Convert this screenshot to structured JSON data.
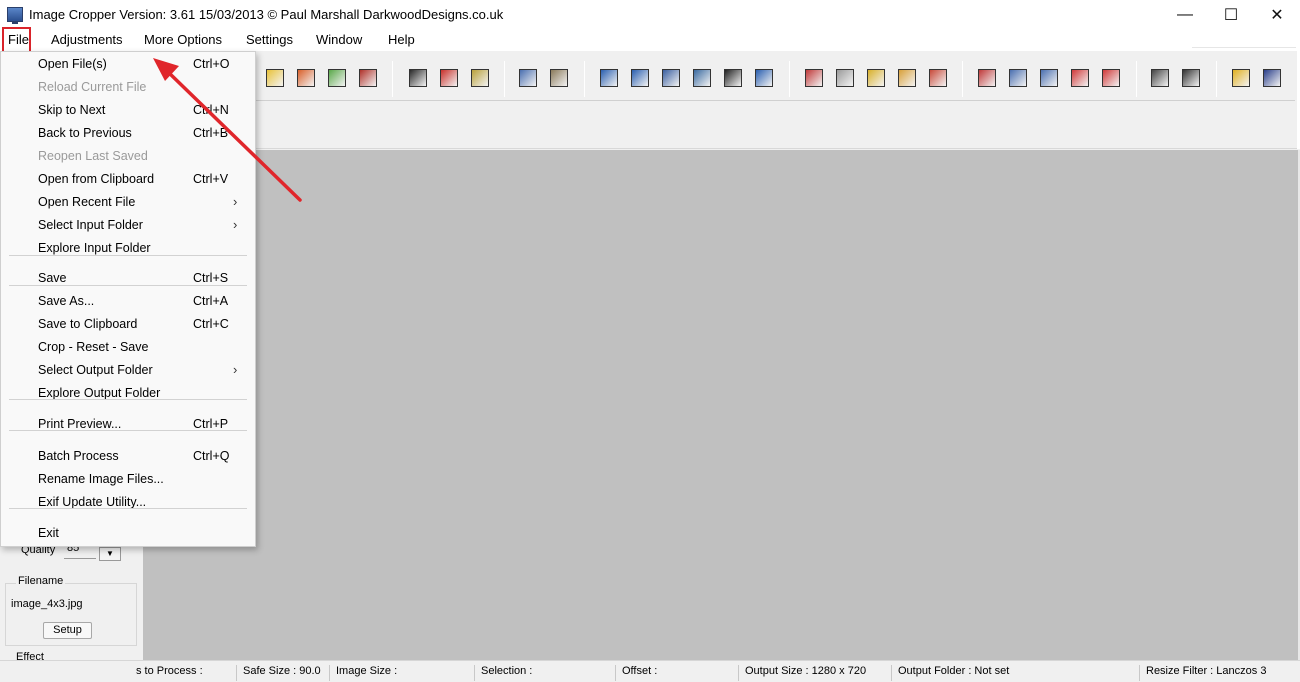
{
  "window": {
    "title": "Image Cropper  Version: 3.61  15/03/2013  © Paul Marshall     DarkwoodDesigns.co.uk",
    "minimize": "—",
    "maximize": "☐",
    "close": "✕"
  },
  "menubar": {
    "file": "File",
    "adjustments": "Adjustments",
    "more_options": "More Options",
    "settings": "Settings",
    "window": "Window",
    "help": "Help"
  },
  "file_menu": {
    "items": [
      {
        "label": "Open File(s)",
        "shortcut": "Ctrl+O",
        "disabled": false
      },
      {
        "label": "Reload Current File",
        "shortcut": "",
        "disabled": true
      },
      {
        "label": "Skip to Next",
        "shortcut": "Ctrl+N",
        "disabled": false
      },
      {
        "label": "Back to Previous",
        "shortcut": "Ctrl+B",
        "disabled": false
      },
      {
        "label": "Reopen Last Saved",
        "shortcut": "",
        "disabled": true
      },
      {
        "label": "Open from Clipboard",
        "shortcut": "Ctrl+V",
        "disabled": false
      },
      {
        "label": "Open Recent File",
        "submenu": true
      },
      {
        "label": "Select Input Folder",
        "submenu": true
      },
      {
        "label": "Explore Input Folder",
        "shortcut": ""
      },
      {
        "label": "Save",
        "shortcut": "Ctrl+S"
      },
      {
        "label": "Save As...",
        "shortcut": "Ctrl+A"
      },
      {
        "label": "Save to Clipboard",
        "shortcut": "Ctrl+C"
      },
      {
        "label": "Crop - Reset - Save",
        "shortcut": ""
      },
      {
        "label": "Select Output Folder",
        "submenu": true
      },
      {
        "label": "Explore Output Folder",
        "shortcut": ""
      },
      {
        "label": "Print Preview...",
        "shortcut": "Ctrl+P"
      },
      {
        "label": "Batch Process",
        "shortcut": "Ctrl+Q"
      },
      {
        "label": "Rename Image Files...",
        "shortcut": ""
      },
      {
        "label": "Exif Update Utility...",
        "shortcut": ""
      },
      {
        "label": "Exit",
        "shortcut": ""
      }
    ],
    "submenu_arrow": "›"
  },
  "left_panel": {
    "quality_label": "Quality",
    "quality_value": "85",
    "quality_down": "▼",
    "filename_legend": "Filename",
    "filename_value": "image_4x3.jpg",
    "setup_button": "Setup",
    "effect_label": "Effect"
  },
  "statusbar": {
    "to_process": "s to Process :",
    "safe_size": "Safe Size : 90.0",
    "image_size": "Image Size :",
    "selection": "Selection :",
    "offset": "Offset :",
    "output_size": "Output Size : 1280 x 720",
    "output_folder": "Output Folder : Not set",
    "resize_filter": "Resize Filter : Lanczos 3"
  },
  "toolbar_icons": [
    "open-folder-icon",
    "open-images-icon",
    "print-icon",
    "batch-icon",
    "save-icon",
    "save-red-icon",
    "save-multi-icon",
    "copy-icon",
    "paste-icon",
    "rotate-right-icon",
    "rotate-left-icon",
    "flip-icon",
    "flip-horizontal-icon",
    "grayscale-icon",
    "undo-icon",
    "frame-icon",
    "blank-icon",
    "fit-height-icon",
    "fit-width-icon",
    "stretch-icon",
    "preview-icon",
    "grid-icon",
    "grid-center-icon",
    "crop-corners-icon",
    "crop-lines-icon",
    "exif-icon",
    "info-icon",
    "folder-f-icon",
    "screen-icon"
  ],
  "colors": {
    "highlight_red": "#d9232a",
    "canvas": "#c0c0c0",
    "menu_bg": "#f9f9f9"
  }
}
